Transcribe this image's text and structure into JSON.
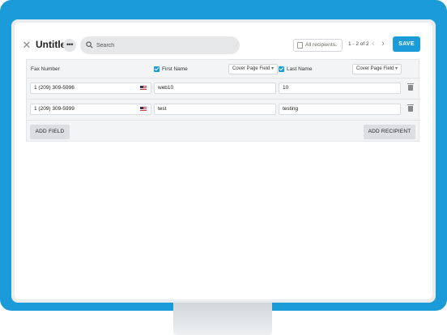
{
  "toolbar": {
    "title": "Untitled",
    "more_label": "•••",
    "close_icon": "close-icon",
    "search_placeholder": "Search",
    "filter_label": "All recipients",
    "pagination": "1 - 2 of 2",
    "save_label": "SAVE"
  },
  "table": {
    "columns": {
      "fax": "Fax Number",
      "first": "First Name",
      "last": "Last Name",
      "field_type_1": "Cover Page Field",
      "field_type_2": "Cover Page Field"
    },
    "rows": [
      {
        "fax": "1 (209) 309-5996",
        "first": "web10",
        "last": "10"
      },
      {
        "fax": "1 (209) 309-5999",
        "first": "test",
        "last": "testing"
      }
    ]
  },
  "actions": {
    "add_field": "ADD FIELD",
    "add_recipient": "ADD RECIPIENT"
  },
  "colors": {
    "accent": "#1b9cd8"
  }
}
